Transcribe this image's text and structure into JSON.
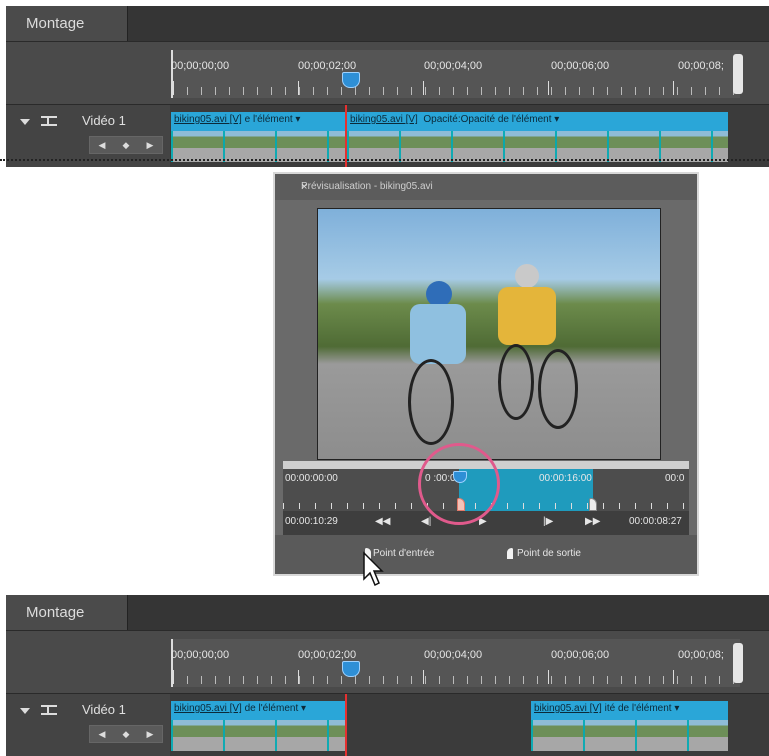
{
  "montage_top": {
    "tab": "Montage",
    "timecodes": [
      "00;00;00;00",
      "00;00;02;00",
      "00;00;04;00",
      "00;00;06;00",
      "00;00;08;"
    ],
    "track_name": "Vidéo 1",
    "keyframe_nav": [
      "◀",
      "◆",
      "▶"
    ],
    "clips": [
      {
        "file": "biking05.avi [V]",
        "label": "e l'élément ▾"
      },
      {
        "file": "biking05.avi [V]",
        "label": "Opacité:Opacité de l'élément ▾"
      }
    ]
  },
  "preview": {
    "title": "Prévisualisation - biking05.avi",
    "close": "×",
    "tc_start": "00:00:00:00",
    "tc_mid": "0  :00:06",
    "tc_end_marker": "00:00:16:00",
    "tc_right": "00:0",
    "current_time": "00:00:10:29",
    "duration": "00:00:08:27",
    "controls": [
      "◀◀",
      "◀|",
      "▶",
      "|▶",
      "▶▶"
    ],
    "set_in": "Point d'entrée",
    "set_out": "Point de sortie"
  },
  "montage_bottom": {
    "tab": "Montage",
    "timecodes": [
      "00;00;00;00",
      "00;00;02;00",
      "00;00;04;00",
      "00;00;06;00",
      "00;00;08;"
    ],
    "track_name": "Vidéo 1",
    "keyframe_nav": [
      "◀",
      "◆",
      "▶"
    ],
    "clips": [
      {
        "file": "biking05.avi [V]",
        "label": "de l'élément ▾"
      },
      {
        "file": "biking05.avi [V]",
        "label": "ité de l'élément ▾"
      }
    ]
  }
}
